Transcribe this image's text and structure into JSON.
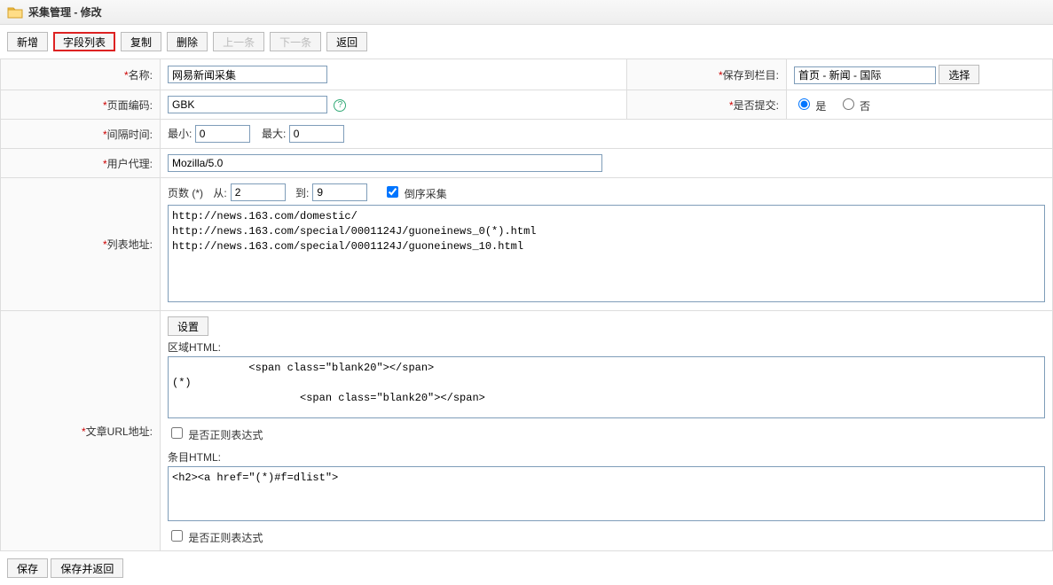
{
  "header": {
    "title": "采集管理 - 修改"
  },
  "toolbar": {
    "add": "新增",
    "fields": "字段列表",
    "copy": "复制",
    "delete": "删除",
    "prev": "上一条",
    "next": "下一条",
    "back": "返回"
  },
  "labels": {
    "name": "名称:",
    "saveCol": "保存到栏目:",
    "pageEnc": "页面编码:",
    "submitQ": "是否提交:",
    "interval": "间隔时间:",
    "ua": "用户代理:",
    "listUrl": "列表地址:",
    "artUrl": "文章URL地址:",
    "pagesPrefix": "页数 (*)",
    "from": "从:",
    "to": "到:",
    "reverse": "倒序采集",
    "min": "最小:",
    "max": "最大:",
    "setBtn": "设置",
    "areaHtml": "区域HTML:",
    "itemHtml": "条目HTML:",
    "isRegex": "是否正则表达式",
    "yes": "是",
    "no": "否",
    "selectBtn": "选择"
  },
  "values": {
    "name": "网易新闻采集",
    "col": "首页 - 新闻 - 国际",
    "enc": "GBK",
    "submit": "yes",
    "min": "0",
    "max": "0",
    "ua": "Mozilla/5.0",
    "pageFrom": "2",
    "pageTo": "9",
    "reverse": true,
    "listUrls": "http://news.163.com/domestic/\nhttp://news.163.com/special/0001124J/guoneinews_0(*).html\nhttp://news.163.com/special/0001124J/guoneinews_10.html",
    "areaHtml": "            <span class=\"blank20\"></span>\n(*)\n                    <span class=\"blank20\"></span>",
    "areaRegex": false,
    "itemHtml": "<h2><a href=\"(*)#f=dlist\">",
    "itemRegex": false
  },
  "footer": {
    "save": "保存",
    "saveReturn": "保存并返回"
  }
}
